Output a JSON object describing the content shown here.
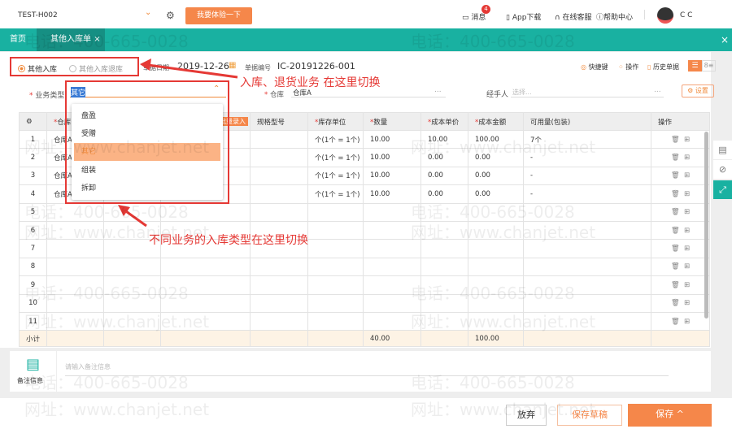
{
  "header": {
    "company": "TEST-H002",
    "try_button": "我要体验一下",
    "messages": "消息",
    "message_badge": "4",
    "app_download": "App下载",
    "online_service": "在线客服",
    "help_center": "帮助中心",
    "user": "C C"
  },
  "tabs": [
    {
      "label": "首页"
    },
    {
      "label": "其他入库单",
      "close": "×"
    }
  ],
  "close_all": "×",
  "form": {
    "radio_options": [
      {
        "label": "其他入库",
        "checked": true
      },
      {
        "label": "其他入库退库",
        "checked": false
      }
    ],
    "date_label": "单据日期",
    "date_value": "2019-12-26",
    "doc_no_label": "单据编号",
    "doc_no_value": "IC-20191226-001",
    "toolbar": {
      "shortcuts": "快捷键",
      "operations": "操作",
      "history": "历史单据"
    },
    "business_type_label": "业务类型",
    "business_type_value": "其它",
    "warehouse_label": "仓库",
    "warehouse_value": "仓库A",
    "more": "...",
    "handler_label": "经手人",
    "handler_placeholder": "选择...",
    "settings": "设置"
  },
  "dropdown": {
    "options": [
      {
        "label": "盘盈",
        "selected": false
      },
      {
        "label": "受赠",
        "selected": false
      },
      {
        "label": "其它",
        "selected": true
      },
      {
        "label": "组装",
        "selected": false
      },
      {
        "label": "拆卸",
        "selected": false
      }
    ]
  },
  "table": {
    "headers": {
      "warehouse": "仓库",
      "batch_entry": "批量录入",
      "spec": "规格型号",
      "unit": "库存单位",
      "qty": "数量",
      "unit_cost": "成本单价",
      "amount": "成本金额",
      "available": "可用量(包装)",
      "ops": "操作"
    },
    "rows": [
      {
        "no": "1",
        "warehouse": "仓库A",
        "unit": "个(1个 = 1个)",
        "qty": "10.00",
        "unit_cost": "10.00",
        "amount": "100.00",
        "available": "7个"
      },
      {
        "no": "2",
        "warehouse": "仓库A",
        "unit": "个(1个 = 1个)",
        "qty": "10.00",
        "unit_cost": "0.00",
        "amount": "0.00",
        "available": "-"
      },
      {
        "no": "3",
        "warehouse": "仓库A",
        "unit": "个(1个 = 1个)",
        "qty": "10.00",
        "unit_cost": "0.00",
        "amount": "0.00",
        "available": "-"
      },
      {
        "no": "4",
        "warehouse": "仓库A",
        "unit": "个(1个 = 1个)",
        "qty": "10.00",
        "unit_cost": "0.00",
        "amount": "0.00",
        "available": "-"
      },
      {
        "no": "5"
      },
      {
        "no": "6"
      },
      {
        "no": "7"
      },
      {
        "no": "8"
      },
      {
        "no": "9"
      },
      {
        "no": "10"
      },
      {
        "no": "11"
      }
    ],
    "subtotal": {
      "label": "小计",
      "qty": "40.00",
      "amount": "100.00"
    }
  },
  "remark": {
    "label": "备注信息",
    "placeholder": "请输入备注信息"
  },
  "footer": {
    "discard": "放弃",
    "save_draft": "保存草稿",
    "save": "保存"
  },
  "annotations": {
    "top": "入库、退货业务 在这里切换",
    "bottom": "不同业务的入库类型在这里切换"
  },
  "watermark": {
    "phone": "电话：400-665-0028",
    "site": "网址：www.chanjet.net"
  },
  "colors": {
    "teal": "#19b1a1",
    "orange": "#f5874a",
    "red_annotation": "#e53935"
  }
}
